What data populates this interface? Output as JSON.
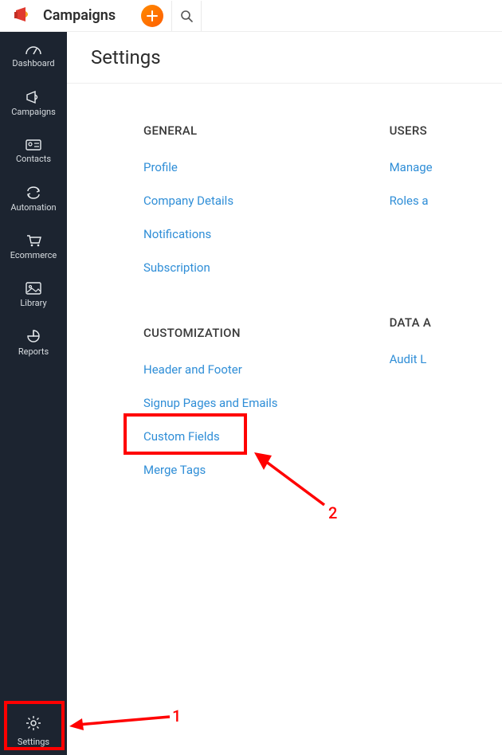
{
  "app": {
    "name": "Campaigns"
  },
  "sidebar": [
    {
      "key": "dashboard",
      "label": "Dashboard"
    },
    {
      "key": "campaigns",
      "label": "Campaigns"
    },
    {
      "key": "contacts",
      "label": "Contacts"
    },
    {
      "key": "automation",
      "label": "Automation"
    },
    {
      "key": "ecommerce",
      "label": "Ecommerce"
    },
    {
      "key": "library",
      "label": "Library"
    },
    {
      "key": "reports",
      "label": "Reports"
    }
  ],
  "sidebar_bottom": {
    "label": "Settings"
  },
  "page": {
    "title": "Settings"
  },
  "settings": {
    "col1": {
      "section1": {
        "title": "GENERAL",
        "links": [
          "Profile",
          "Company Details",
          "Notifications",
          "Subscription"
        ]
      },
      "section2": {
        "title": "CUSTOMIZATION",
        "links": [
          "Header and Footer",
          "Signup Pages and Emails",
          "Custom Fields",
          "Merge Tags"
        ]
      }
    },
    "col2": {
      "section1": {
        "title": "USERS",
        "links": [
          "Manage",
          "Roles a"
        ]
      },
      "section2": {
        "title": "DATA A",
        "links": [
          "Audit L"
        ]
      }
    }
  },
  "annotations": {
    "label1": "1",
    "label2": "2"
  }
}
